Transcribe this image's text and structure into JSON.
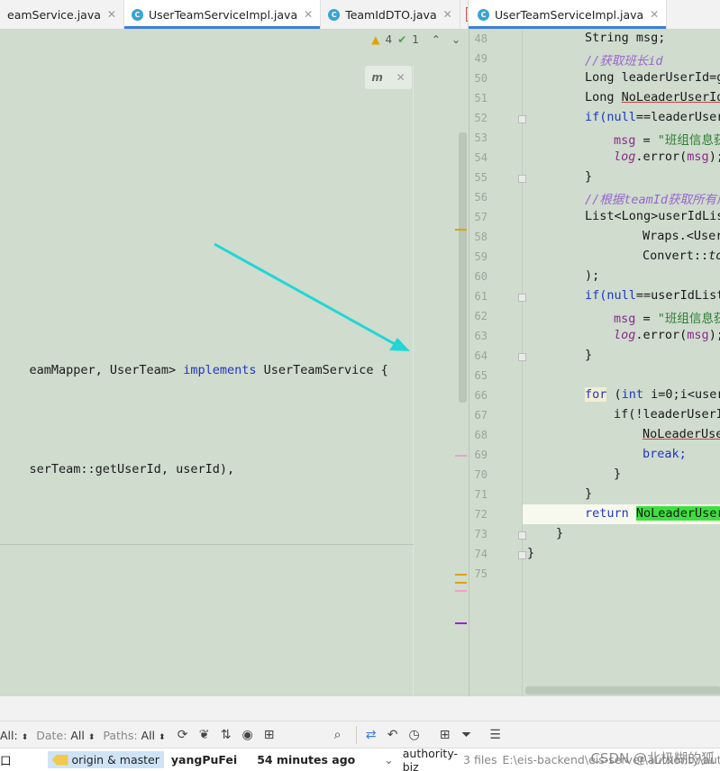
{
  "left_tabs": [
    {
      "label": "eamService.java",
      "active": false,
      "icon": false
    },
    {
      "label": "UserTeamServiceImpl.java",
      "active": true,
      "icon": true
    },
    {
      "label": "TeamIdDTO.java",
      "active": false,
      "icon": true
    }
  ],
  "right_tabs": [
    {
      "label": "UserTeamServiceImpl.java",
      "active": true,
      "icon": true
    }
  ],
  "inspections": {
    "warnings": "4",
    "checks": "1"
  },
  "left_code": {
    "class_decl_pre": "eamMapper, UserTeam> ",
    "class_decl_kw": "implements",
    "class_decl_post": " UserTeamService {",
    "line2": "serTeam::getUserId, userId),"
  },
  "right_code": [
    {
      "n": "48"
    },
    {
      "n": "49"
    },
    {
      "n": "50"
    },
    {
      "n": "51"
    },
    {
      "n": "52"
    },
    {
      "n": "53"
    },
    {
      "n": "54"
    },
    {
      "n": "55"
    },
    {
      "n": "56"
    },
    {
      "n": "57"
    },
    {
      "n": "58"
    },
    {
      "n": "59"
    },
    {
      "n": "60"
    },
    {
      "n": "61"
    },
    {
      "n": "62"
    },
    {
      "n": "63"
    },
    {
      "n": "64"
    },
    {
      "n": "65"
    },
    {
      "n": "66"
    },
    {
      "n": "67"
    },
    {
      "n": "68"
    },
    {
      "n": "69"
    },
    {
      "n": "70"
    },
    {
      "n": "71"
    },
    {
      "n": "72"
    },
    {
      "n": "73"
    },
    {
      "n": "74"
    },
    {
      "n": "75"
    }
  ],
  "code_text": {
    "l48": "String msg;",
    "l49": "//获取班长id",
    "l50": "Long leaderUserId=g",
    "l51a": "Long ",
    "l51b": "NoLeaderUserId",
    "l52a": "if(",
    "l52b": "null",
    "l52c": "==leaderUser",
    "l53a": "msg",
    "l53b": " = ",
    "l53c": "\"班组信息获",
    "l54a": "log",
    "l54b": ".error(",
    "l54c": "msg",
    "l54d": ");",
    "l55": "}",
    "l56": "//根据teamId获取所有成",
    "l57": "List<Long>userIdLis",
    "l58": "Wraps.<User",
    "l59a": "Convert::",
    "l59b": "to",
    "l60": ");",
    "l61a": "if(",
    "l61b": "null",
    "l61c": "==userIdList",
    "l62a": "msg",
    "l62b": " = ",
    "l62c": "\"班组信息获",
    "l63a": "log",
    "l63b": ".error(",
    "l63c": "msg",
    "l63d": ");",
    "l64": "}",
    "l66a": "for",
    "l66b": " (",
    "l66c": "int",
    "l66d": " i=0;i<user",
    "l67": "if(!leaderUserI",
    "l68": "NoLeaderUse",
    "l69": "break;",
    "l70": "}",
    "l71": "}",
    "l72a": "return",
    "l72b": "NoLeaderUser",
    "l73": "}",
    "l74": "}"
  },
  "toolbar": {
    "all_label": "All:",
    "date_label": "Date:",
    "date_value": "All",
    "paths_label": "Paths:",
    "paths_value": "All"
  },
  "status": {
    "left_char": "口",
    "branch": "origin & master",
    "author": "yangPuFei",
    "time": "54 minutes ago",
    "module": "authority-biz",
    "files": "3 files",
    "path": "E:\\eis-backend\\eis-server\\authority\\authori",
    "watermark": "CSDN @北极糊的狐"
  },
  "colors": {
    "editor_bg": "#cfdcce",
    "keyword": "#1f36c0",
    "comment": "#9966cc",
    "string": "#2e7d32",
    "arrow": "#22d6d6",
    "highlight": "#3ee03e"
  }
}
